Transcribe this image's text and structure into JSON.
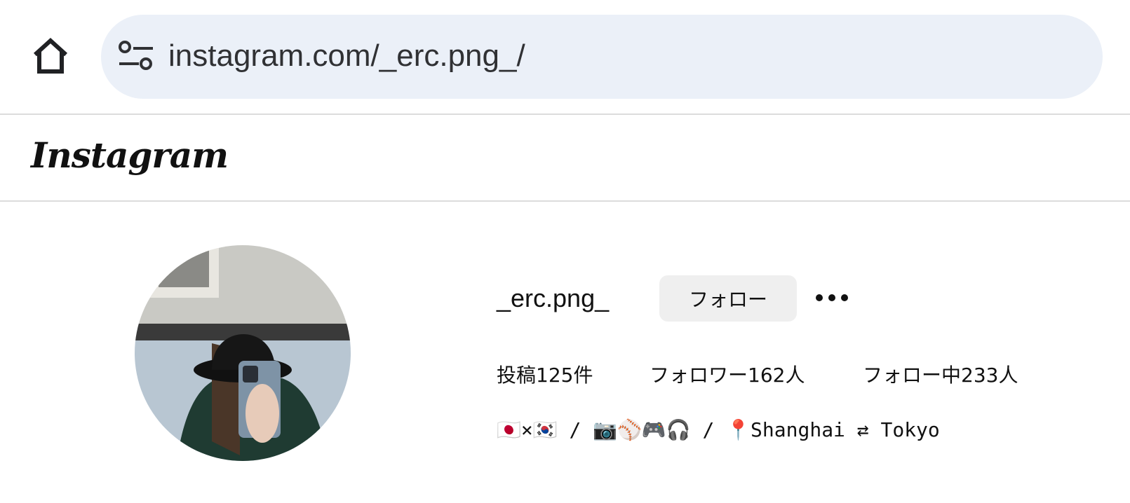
{
  "browser": {
    "url": "instagram.com/_erc.png_/"
  },
  "header": {
    "logo": "Instagram"
  },
  "profile": {
    "username": "_erc.png_",
    "follow_label": "フォロー",
    "stats": {
      "posts": "投稿125件",
      "followers": "フォロワー162人",
      "following": "フォロー中233人"
    },
    "bio": "🇯🇵×🇰🇷 / 📷⚾🎮🎧 / 📍Shanghai ⇄ Tokyo"
  },
  "icons": {
    "home": "home-icon",
    "site_info": "site-info-icon",
    "more": "more-horizontal-icon"
  }
}
